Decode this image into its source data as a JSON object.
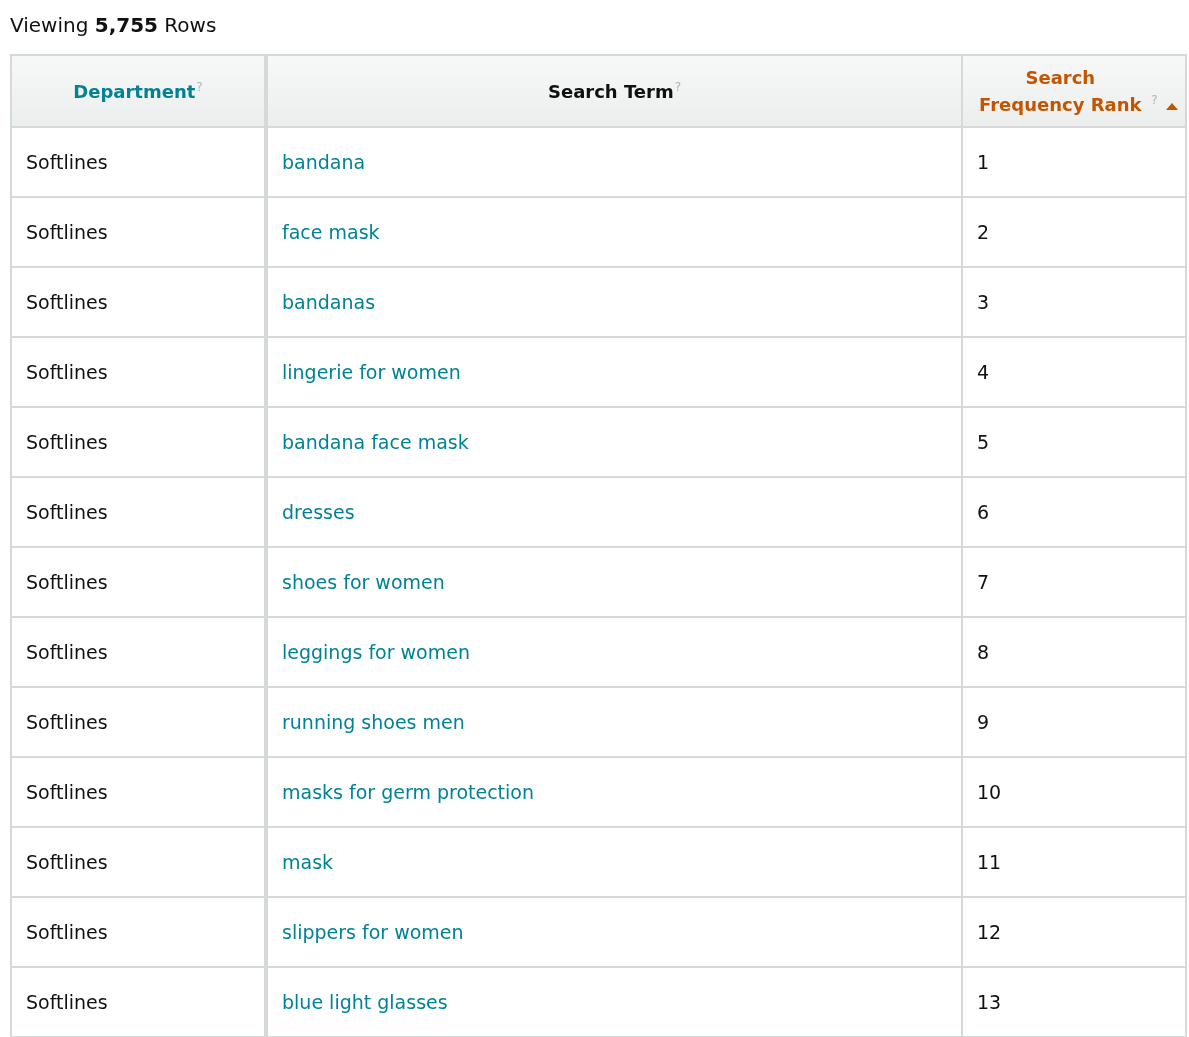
{
  "summary": {
    "prefix": "Viewing",
    "count": "5,755",
    "suffix": "Rows"
  },
  "table": {
    "columns": [
      {
        "label": "Department",
        "help": "?",
        "sortable": true,
        "sorted": false
      },
      {
        "label": "Search Term",
        "help": "?",
        "sortable": false,
        "sorted": false
      },
      {
        "label": "Search Frequency Rank",
        "help": "?",
        "sortable": true,
        "sorted": true
      }
    ],
    "rows": [
      {
        "department": "Softlines",
        "search_term": "bandana",
        "rank": "1"
      },
      {
        "department": "Softlines",
        "search_term": "face mask",
        "rank": "2"
      },
      {
        "department": "Softlines",
        "search_term": "bandanas",
        "rank": "3"
      },
      {
        "department": "Softlines",
        "search_term": "lingerie for women",
        "rank": "4"
      },
      {
        "department": "Softlines",
        "search_term": "bandana face mask",
        "rank": "5"
      },
      {
        "department": "Softlines",
        "search_term": "dresses",
        "rank": "6"
      },
      {
        "department": "Softlines",
        "search_term": "shoes for women",
        "rank": "7"
      },
      {
        "department": "Softlines",
        "search_term": "leggings for women",
        "rank": "8"
      },
      {
        "department": "Softlines",
        "search_term": "running shoes men",
        "rank": "9"
      },
      {
        "department": "Softlines",
        "search_term": "masks for germ protection",
        "rank": "10"
      },
      {
        "department": "Softlines",
        "search_term": "mask",
        "rank": "11"
      },
      {
        "department": "Softlines",
        "search_term": "slippers for women",
        "rank": "12"
      },
      {
        "department": "Softlines",
        "search_term": "blue light glasses",
        "rank": "13"
      }
    ]
  }
}
